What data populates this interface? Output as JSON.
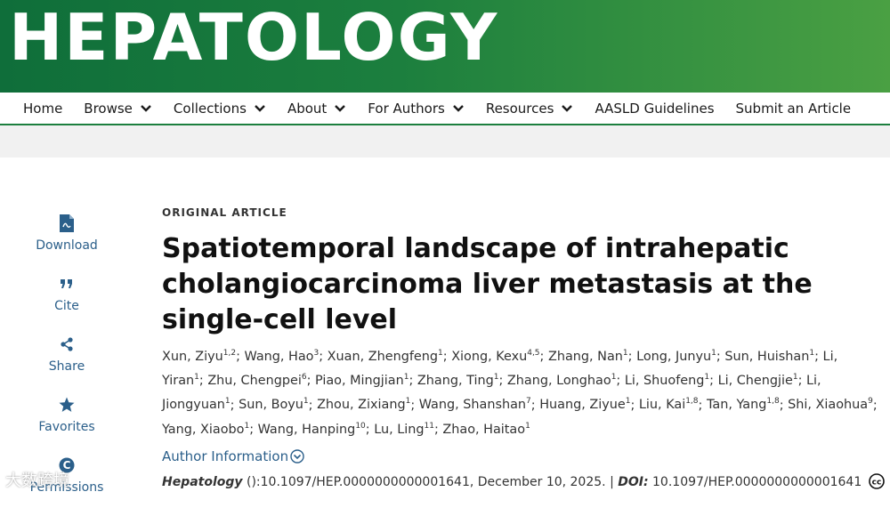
{
  "journal": {
    "logo_text": "HEPATOLOGY"
  },
  "nav": {
    "items": [
      {
        "label": "Home"
      },
      {
        "label": "Browse"
      },
      {
        "label": "Collections"
      },
      {
        "label": "About"
      },
      {
        "label": "For Authors"
      },
      {
        "label": "Resources"
      },
      {
        "label": "AASLD Guidelines"
      },
      {
        "label": "Submit an Article"
      }
    ]
  },
  "sidebar": {
    "download": "Download",
    "cite": "Cite",
    "share": "Share",
    "favorites": "Favorites",
    "permissions": "Permissions"
  },
  "article": {
    "type": "ORIGINAL ARTICLE",
    "title": "Spatiotemporal landscape of intrahepatic cholangiocarcinoma liver metastasis at the single-cell level",
    "authors": [
      {
        "name": "Xun, Ziyu",
        "aff": "1,2"
      },
      {
        "name": "Wang, Hao",
        "aff": "3"
      },
      {
        "name": "Xuan, Zhengfeng",
        "aff": "1"
      },
      {
        "name": "Xiong, Kexu",
        "aff": "4,5"
      },
      {
        "name": "Zhang, Nan",
        "aff": "1"
      },
      {
        "name": "Long, Junyu",
        "aff": "1"
      },
      {
        "name": "Sun, Huishan",
        "aff": "1"
      },
      {
        "name": "Li, Yiran",
        "aff": "1"
      },
      {
        "name": "Zhu, Chengpei",
        "aff": "6"
      },
      {
        "name": "Piao, Mingjian",
        "aff": "1"
      },
      {
        "name": "Zhang, Ting",
        "aff": "1"
      },
      {
        "name": "Zhang, Longhao",
        "aff": "1"
      },
      {
        "name": "Li, Shuofeng",
        "aff": "1"
      },
      {
        "name": "Li, Chengjie",
        "aff": "1"
      },
      {
        "name": "Li, Jiongyuan",
        "aff": "1"
      },
      {
        "name": "Sun, Boyu",
        "aff": "1"
      },
      {
        "name": "Zhou, Zixiang",
        "aff": "1"
      },
      {
        "name": "Wang, Shanshan",
        "aff": "7"
      },
      {
        "name": "Huang, Ziyue",
        "aff": "1"
      },
      {
        "name": "Liu, Kai",
        "aff": "1,8"
      },
      {
        "name": "Tan, Yang",
        "aff": "1,8"
      },
      {
        "name": "Shi, Xiaohua",
        "aff": "9"
      },
      {
        "name": "Yang, Xiaobo",
        "aff": "1"
      },
      {
        "name": "Wang, Hanping",
        "aff": "10"
      },
      {
        "name": "Lu, Ling",
        "aff": "11"
      },
      {
        "name": "Zhao, Haitao",
        "aff": "1"
      }
    ],
    "author_info_link": "Author Information",
    "citation": {
      "journal": "Hepatology",
      "ref": " ():10.1097/HEP.0000000000001641, December 10, 2025. ",
      "separator": "|",
      "doi_label": "DOI:",
      "doi": " 10.1097/HEP.0000000000001641"
    }
  },
  "watermark": "大数跨境",
  "colors": {
    "brand_green": "#1c7f3e",
    "link_blue": "#2b5f8a"
  }
}
